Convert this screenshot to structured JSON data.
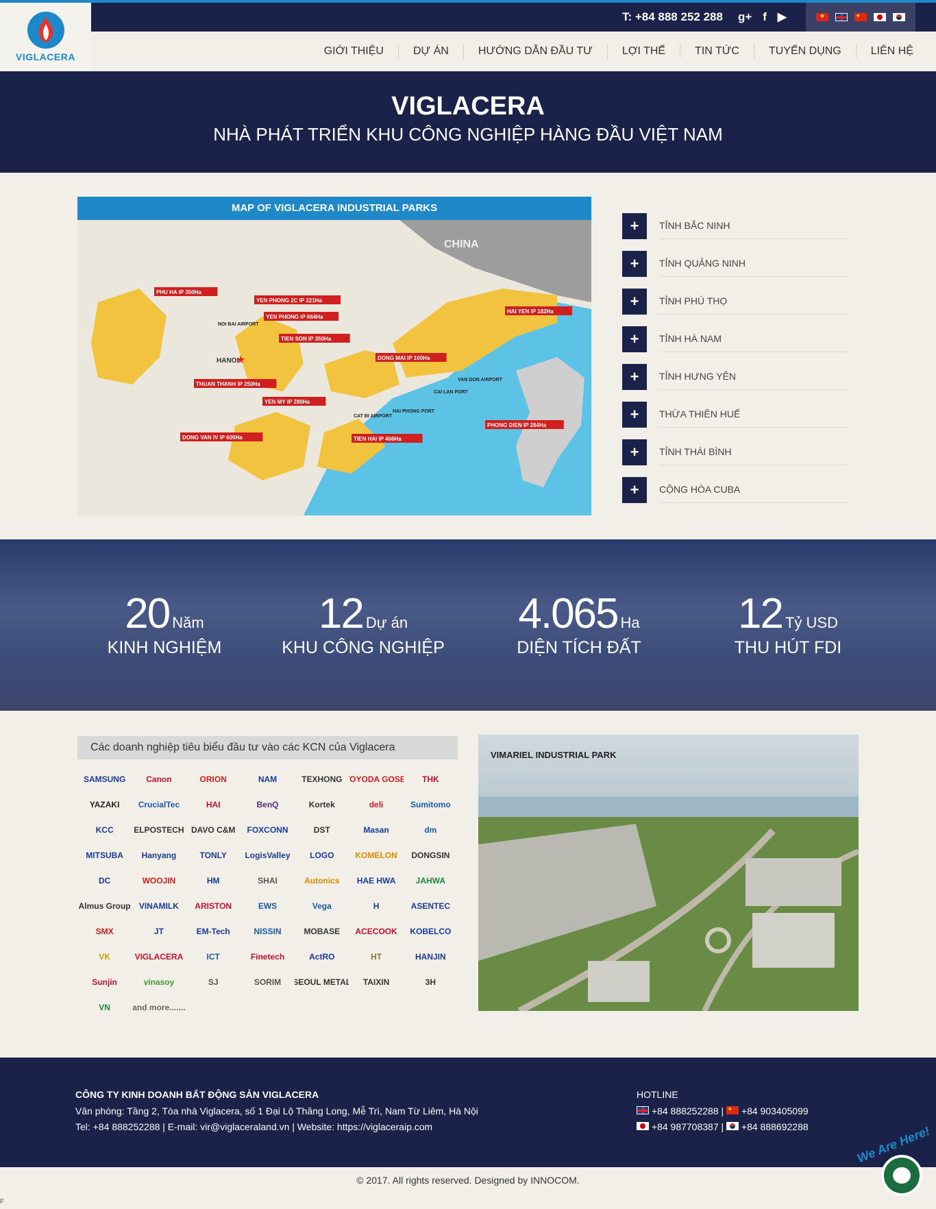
{
  "brand": {
    "name": "VIGLACERA"
  },
  "topbar": {
    "phone": "T:  +84 888 252 288",
    "gplus": "g+",
    "facebook": "f",
    "youtube": "▶"
  },
  "nav": {
    "items": [
      "GIỚI THIỆU",
      "DỰ ÁN",
      "HƯỚNG DẪN ĐẦU TƯ",
      "LỢI THẾ",
      "TIN TỨC",
      "TUYỂN DỤNG",
      "LIÊN HỆ"
    ]
  },
  "hero": {
    "title": "VIGLACERA",
    "subtitle": "NHÀ PHÁT TRIỂN KHU CÔNG NGHIỆP HÀNG ĐẦU VIỆT NAM"
  },
  "map": {
    "title": "MAP OF VIGLACERA INDUSTRIAL PARKS",
    "country_label": "CHINA",
    "city_label": "HANOI",
    "parks": [
      {
        "name": "PHU HA IP",
        "area": "350Ha"
      },
      {
        "name": "YEN PHONG 2C IP",
        "area": "221Ha"
      },
      {
        "name": "YEN PHONG IP",
        "area": "664Ha"
      },
      {
        "name": "TIEN SON IP",
        "area": "350Ha"
      },
      {
        "name": "THUAN THANH IP",
        "area": "250Ha"
      },
      {
        "name": "YEN MY IP",
        "area": "280Ha"
      },
      {
        "name": "DONG VAN IV IP",
        "area": "600Ha"
      },
      {
        "name": "DONG MAI IP",
        "area": "160Ha"
      },
      {
        "name": "TIEN HAI IP",
        "area": "466Ha"
      },
      {
        "name": "HAI YEN IP",
        "area": "182Ha"
      },
      {
        "name": "PHONG DIEN IP",
        "area": "284Ha"
      }
    ],
    "places": [
      "NOI BAI AIRPORT",
      "VAN DON AIRPORT",
      "CAI LAN PORT",
      "CAT BI AIRPORT",
      "HAI PHONG PORT"
    ]
  },
  "provinces": {
    "button": "+",
    "items": [
      "TỈNH BẮC NINH",
      "TỈNH QUẢNG NINH",
      "TỈNH PHÚ THỌ",
      "TỈNH HÀ NAM",
      "TỈNH HƯNG YÊN",
      "THỪA THIÊN HUẾ",
      "TỈNH THÁI BÌNH",
      "CỘNG HÒA CUBA"
    ]
  },
  "stats": [
    {
      "number": "20",
      "unit": "Năm",
      "label": "KINH NGHIỆM"
    },
    {
      "number": "12",
      "unit": "Dự án",
      "label": "KHU CÔNG NGHIỆP"
    },
    {
      "number": "4.065",
      "unit": "Ha",
      "label": "DIỆN TÍCH ĐẤT"
    },
    {
      "number": "12",
      "unit": "Tỷ USD",
      "label": "THU HÚT FDI"
    }
  ],
  "partners": {
    "title": "Các doanh nghiệp tiêu biểu đầu tư vào các KCN của Viglacera",
    "logos": [
      {
        "text": "SAMSUNG",
        "color": "#1a3b9c"
      },
      {
        "text": "Canon",
        "color": "#c8102e"
      },
      {
        "text": "ORION",
        "color": "#d42020"
      },
      {
        "text": "NAM",
        "color": "#1a3b9c"
      },
      {
        "text": "TEXHONG",
        "color": "#333333"
      },
      {
        "text": "TOYODA GOSEI",
        "color": "#d42020"
      },
      {
        "text": "THK",
        "color": "#c8102e"
      },
      {
        "text": "YAZAKI",
        "color": "#222222"
      },
      {
        "text": "CrucialTec",
        "color": "#1e5aa8"
      },
      {
        "text": "HAI",
        "color": "#c8102e"
      },
      {
        "text": "BenQ",
        "color": "#5b2a86"
      },
      {
        "text": "Kortek",
        "color": "#333333"
      },
      {
        "text": "deli",
        "color": "#d42020"
      },
      {
        "text": "Sumitomo",
        "color": "#1a5aa8"
      },
      {
        "text": "KCC",
        "color": "#1a3b9c"
      },
      {
        "text": "ELPOSTECH",
        "color": "#333333"
      },
      {
        "text": "DAVO C&M",
        "color": "#333333"
      },
      {
        "text": "FOXCONN",
        "color": "#1a3b9c"
      },
      {
        "text": "DST",
        "color": "#333333"
      },
      {
        "text": "Masan",
        "color": "#1a3b9c"
      },
      {
        "text": "dm",
        "color": "#1a5aa8"
      },
      {
        "text": "MITSUBA",
        "color": "#1a3b9c"
      },
      {
        "text": "Hanyang",
        "color": "#1a3b9c"
      },
      {
        "text": "TONLY",
        "color": "#1a3b9c"
      },
      {
        "text": "LogisValley",
        "color": "#1a3b9c"
      },
      {
        "text": "LOGO",
        "color": "#1a3b9c"
      },
      {
        "text": "KOMELON",
        "color": "#e08a00"
      },
      {
        "text": "DONGSIN",
        "color": "#333333"
      },
      {
        "text": "DC",
        "color": "#1a3b9c"
      },
      {
        "text": "WOOJIN",
        "color": "#d42020"
      },
      {
        "text": "HM",
        "color": "#1a3b9c"
      },
      {
        "text": "SHAI",
        "color": "#555555"
      },
      {
        "text": "Autonics",
        "color": "#e08a00"
      },
      {
        "text": "HAE HWA",
        "color": "#1a3b9c"
      },
      {
        "text": "JAHWA",
        "color": "#1a8a3a"
      },
      {
        "text": "Almus Group",
        "color": "#333333"
      },
      {
        "text": "VINAMILK",
        "color": "#1a3b9c"
      },
      {
        "text": "ARISTON",
        "color": "#c8102e"
      },
      {
        "text": "EWS",
        "color": "#1a5aa8"
      },
      {
        "text": "Vega",
        "color": "#1a5aa8"
      },
      {
        "text": "H",
        "color": "#1a3b9c"
      },
      {
        "text": "ASENTEC",
        "color": "#1a3b9c"
      },
      {
        "text": "SMX",
        "color": "#d42020"
      },
      {
        "text": "JT",
        "color": "#1a3b9c"
      },
      {
        "text": "EM-Tech",
        "color": "#1a3b9c"
      },
      {
        "text": "NISSIN",
        "color": "#1a5aa8"
      },
      {
        "text": "MOBASE",
        "color": "#333333"
      },
      {
        "text": "ACECOOK",
        "color": "#c8102e"
      },
      {
        "text": "KOBELCO",
        "color": "#1a3b9c"
      },
      {
        "text": "VK",
        "color": "#c8a000"
      },
      {
        "text": "VIGLACERA",
        "color": "#c8102e"
      },
      {
        "text": "ICT",
        "color": "#1a5aa8"
      },
      {
        "text": "Finetech",
        "color": "#c8102e"
      },
      {
        "text": "ActRO",
        "color": "#1a3b9c"
      },
      {
        "text": "HT",
        "color": "#8a7a30"
      },
      {
        "text": "HANJIN",
        "color": "#1a3b9c"
      },
      {
        "text": "Sunjin",
        "color": "#c8102e"
      },
      {
        "text": "vinasoy",
        "color": "#4a9a2a"
      },
      {
        "text": "SJ",
        "color": "#555555"
      },
      {
        "text": "SORIM",
        "color": "#555555"
      },
      {
        "text": "SEOUL METAL",
        "color": "#333333"
      },
      {
        "text": "TAIXIN",
        "color": "#333333"
      },
      {
        "text": "3H",
        "color": "#333333"
      },
      {
        "text": "VN",
        "color": "#1a8a3a"
      },
      {
        "text": "and more.......",
        "color": "#666666"
      }
    ]
  },
  "park_photo": {
    "title": "VIMARIEL INDUSTRIAL PARK"
  },
  "footer": {
    "company": "CÔNG TY KINH DOANH BẤT ĐỘNG SẢN VIGLACERA",
    "address": "Văn phòng: Tầng 2, Tòa nhà Viglacera, số 1 Đại Lộ Thăng Long, Mễ Trì, Nam Từ Liêm, Hà Nội",
    "contact": "Tel: +84 888252288 | E-mail: vir@viglaceraland.vn | Website: https://viglaceraip.com",
    "hotline_label": "HOTLINE",
    "hotline_en": "+84 888252288",
    "hotline_cn": "+84 903405099",
    "hotline_jp": "+84 987708387",
    "hotline_kr": "+84 888692288",
    "separator": "|"
  },
  "copyright": "© 2017. All rights reserved. Designed by INNOCOM.",
  "chat": {
    "badge": "We Are Here!"
  },
  "edge_mark": "F"
}
